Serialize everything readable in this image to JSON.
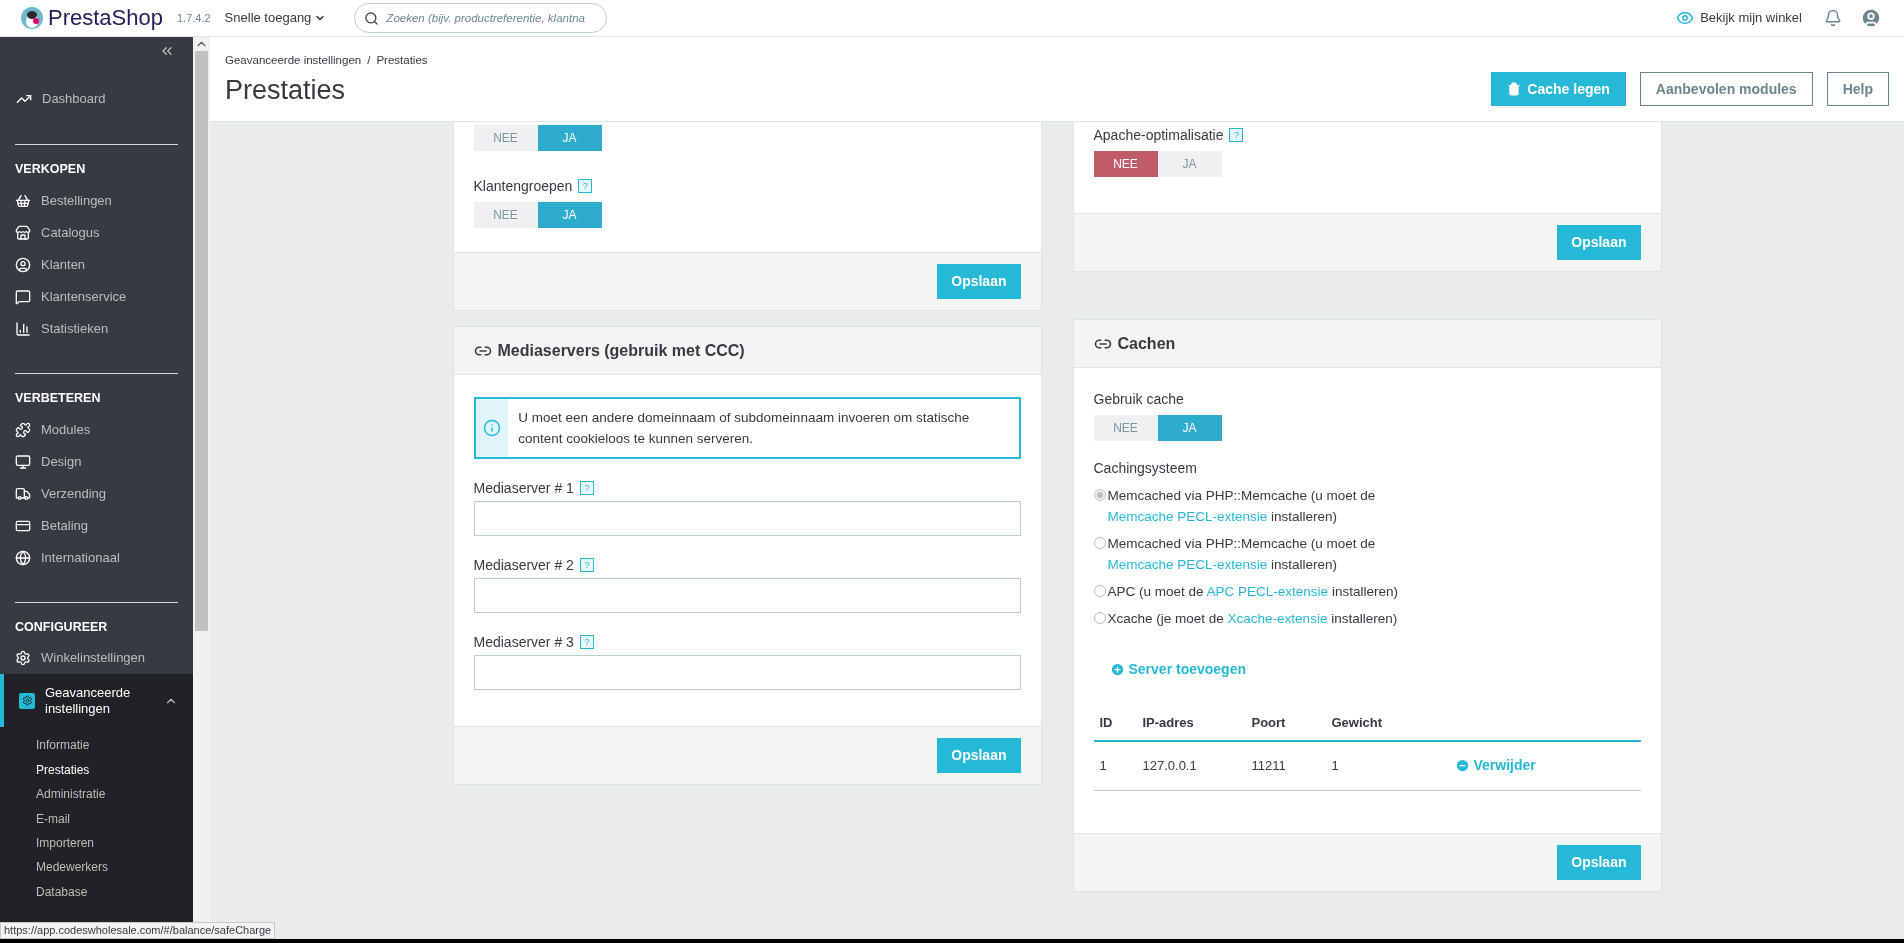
{
  "topbar": {
    "logo": "PrestaShop",
    "version": "1.7.4.2",
    "quick_access": "Snelle toegang",
    "search": {
      "placeholder": "Zoeken (bijv. productreferentie, klantna"
    },
    "view_shop": "Bekijk mijn winkel"
  },
  "sidebar": {
    "top_items": [
      {
        "label": "Dashboard"
      }
    ],
    "sections": [
      {
        "title": "VERKOPEN",
        "items": [
          {
            "label": "Bestellingen",
            "selected": false
          },
          {
            "label": "Catalogus",
            "selected": false
          },
          {
            "label": "Klanten",
            "selected": false
          },
          {
            "label": "Klantenservice",
            "selected": false
          },
          {
            "label": "Statistieken",
            "selected": false
          }
        ]
      },
      {
        "title": "VERBETEREN",
        "items": [
          {
            "label": "Modules",
            "selected": false
          },
          {
            "label": "Design",
            "selected": false
          },
          {
            "label": "Verzending",
            "selected": false
          },
          {
            "label": "Betaling",
            "selected": false
          },
          {
            "label": "Internationaal",
            "selected": false
          }
        ]
      },
      {
        "title": "CONFIGUREER",
        "items": [
          {
            "label": "Winkelinstellingen",
            "selected": false
          },
          {
            "label": "Geavanceerde instellingen",
            "selected": true,
            "expanded": true,
            "children": [
              {
                "label": "Informatie",
                "selected": false
              },
              {
                "label": "Prestaties",
                "selected": true
              },
              {
                "label": "Administratie",
                "selected": false
              },
              {
                "label": "E-mail",
                "selected": false
              },
              {
                "label": "Importeren",
                "selected": false
              },
              {
                "label": "Medewerkers",
                "selected": false
              },
              {
                "label": "Database",
                "selected": false
              }
            ]
          }
        ]
      }
    ]
  },
  "breadcrumb": [
    "Geavanceerde instellingen",
    "Prestaties"
  ],
  "breadcrumb_separator": "/",
  "page_title": "Prestaties",
  "toolbar_buttons": [
    {
      "label": "Cache legen",
      "kind": "primary"
    },
    {
      "label": "Aanbevolen modules",
      "kind": "outline"
    },
    {
      "label": "Help",
      "kind": "outline"
    }
  ],
  "left_panels": [
    {
      "fields": [
        {
          "kind": "toggle",
          "options": [
            {
              "label": "NEE",
              "selected": false
            },
            {
              "label": "JA",
              "selected": true
            }
          ]
        },
        {
          "kind": "toggle",
          "label": "Klantengroepen",
          "help": "?",
          "options": [
            {
              "label": "NEE",
              "selected": false
            },
            {
              "label": "JA",
              "selected": true
            }
          ]
        }
      ],
      "save": "Opslaan"
    },
    {
      "title": "Mediaservers (gebruik met CCC)",
      "alert": "U moet een andere domeinnaam of subdomeinnaam invoeren om statische content cookieloos te kunnen serveren.",
      "fields": [
        {
          "kind": "text",
          "label": "Mediaserver # 1",
          "help": "?"
        },
        {
          "kind": "text",
          "label": "Mediaserver # 2",
          "help": "?"
        },
        {
          "kind": "text",
          "label": "Mediaserver # 3",
          "help": "?"
        }
      ],
      "save": "Opslaan"
    }
  ],
  "right_panels": [
    {
      "fields": [
        {
          "kind": "toggle",
          "label": "Apache-optimalisatie",
          "help": "?",
          "options": [
            {
              "label": "NEE",
              "selected": true
            },
            {
              "label": "JA",
              "selected": false
            }
          ]
        }
      ],
      "save": "Opslaan"
    },
    {
      "title": "Cachen",
      "fields": [
        {
          "kind": "toggle",
          "label": "Gebruik cache",
          "options": [
            {
              "label": "NEE",
              "selected": false
            },
            {
              "label": "JA",
              "selected": true
            }
          ]
        },
        {
          "kind": "radios",
          "label": "Cachingsysteem",
          "options": [
            {
              "before": "Memcached via PHP::Memcache (u moet de ",
              "link": "Memcache PECL-extensie",
              "after": " installeren)",
              "selected": true
            },
            {
              "before": "Memcached via PHP::Memcache (u moet de ",
              "link": "Memcache PECL-extensie",
              "after": " installeren)",
              "selected": false
            },
            {
              "before": "APC (u moet de ",
              "link": "APC PECL-extensie",
              "after": " installeren)",
              "selected": false
            },
            {
              "before": "Xcache (je moet de ",
              "link": "Xcache-extensie",
              "after": " installeren)",
              "selected": false
            }
          ]
        }
      ],
      "add_server": "Server toevoegen",
      "table": {
        "columns": [
          "ID",
          "IP-adres",
          "Poort",
          "Gewicht"
        ],
        "rows": [
          {
            "cells": [
              "1",
              "127.0.0.1",
              "11211",
              "1"
            ],
            "action": "Verwijder"
          }
        ]
      },
      "save": "Opslaan"
    }
  ],
  "status_bar": "https://app.codeswholesale.com/#/balance/safeCharge"
}
